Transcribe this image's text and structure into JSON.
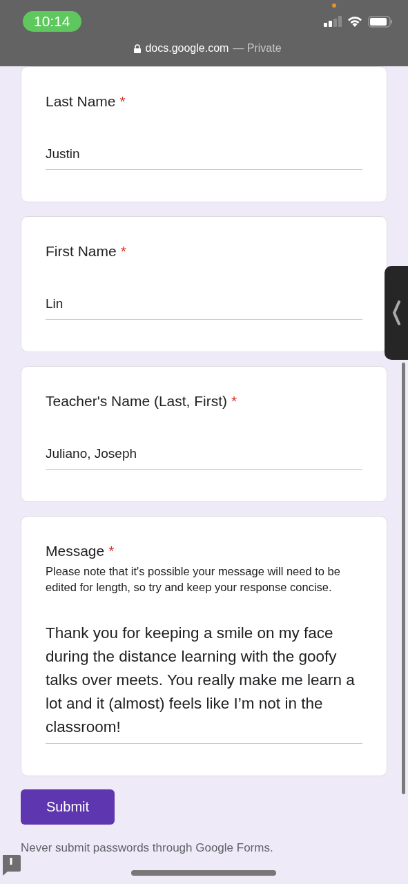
{
  "status_bar": {
    "time": "10:14",
    "url": "docs.google.com",
    "separator": "—",
    "mode": "Private"
  },
  "questions": [
    {
      "kind": "short",
      "label": "Last Name",
      "required_mark": "*",
      "answer": "Justin"
    },
    {
      "kind": "short",
      "label": "First Name",
      "required_mark": "*",
      "answer": "Lin"
    },
    {
      "kind": "short",
      "label": "Teacher's Name (Last, First)",
      "required_mark": "*",
      "answer": "Juliano, Joseph"
    },
    {
      "kind": "paragraph",
      "label": "Message",
      "required_mark": "*",
      "description": "Please note that it's possible your message will need to be edited for length, so try and keep your response concise.",
      "answer": "Thank you for keeping a smile on my face during the distance learning with the goofy talks over meets. You really make me learn a lot and it (almost) feels like I’m not in the classroom!"
    }
  ],
  "submit_button": "Submit",
  "footer_note": "Never submit passwords through Google Forms."
}
